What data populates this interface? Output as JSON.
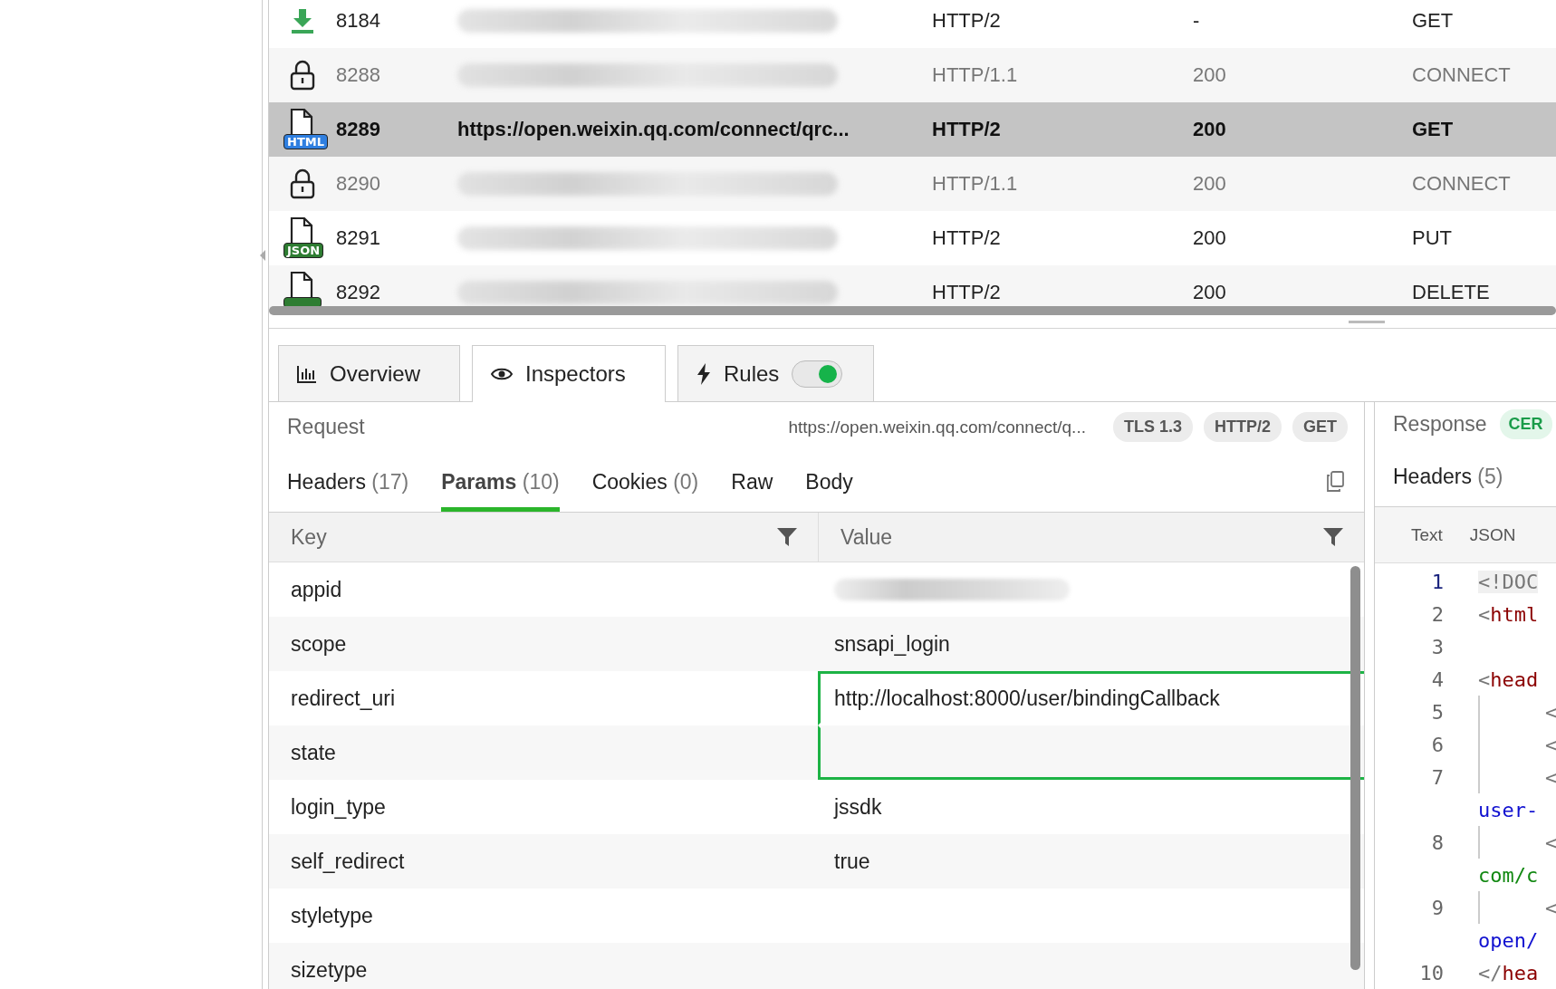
{
  "sessions": [
    {
      "id": "8184",
      "kind": "download",
      "redacted": true,
      "protocol": "HTTP/2",
      "status": "-",
      "method": "GET",
      "selected": false
    },
    {
      "id": "8288",
      "kind": "tunnel",
      "redacted": true,
      "protocol": "HTTP/1.1",
      "status": "200",
      "method": "CONNECT",
      "selected": false
    },
    {
      "id": "8289",
      "kind": "html",
      "badge": "HTML",
      "url": "https://open.weixin.qq.com/connect/qrc...",
      "protocol": "HTTP/2",
      "status": "200",
      "method": "GET",
      "selected": true
    },
    {
      "id": "8290",
      "kind": "tunnel",
      "redacted": true,
      "protocol": "HTTP/1.1",
      "status": "200",
      "method": "CONNECT",
      "selected": false
    },
    {
      "id": "8291",
      "kind": "json",
      "badge": "JSON",
      "redacted": true,
      "protocol": "HTTP/2",
      "status": "200",
      "method": "PUT",
      "selected": false
    },
    {
      "id": "8292",
      "kind": "json",
      "redacted": true,
      "protocol": "HTTP/2",
      "status": "200",
      "method": "DELETE",
      "selected": false
    }
  ],
  "tabs": [
    {
      "kind": "overview",
      "label": "Overview",
      "selected": false
    },
    {
      "kind": "inspectors",
      "label": "Inspectors",
      "selected": true
    },
    {
      "kind": "rules",
      "label": "Rules",
      "selected": false,
      "toggle_on": true
    }
  ],
  "request": {
    "title": "Request",
    "url": "https://open.weixin.qq.com/connect/q...",
    "badges": [
      "TLS 1.3",
      "HTTP/2",
      "GET"
    ],
    "subtabs": [
      {
        "label": "Headers",
        "count": "(17)",
        "selected": false
      },
      {
        "label": "Params",
        "count": "(10)",
        "selected": true
      },
      {
        "label": "Cookies",
        "count": "(0)",
        "selected": false
      },
      {
        "label": "Raw",
        "selected": false
      },
      {
        "label": "Body",
        "selected": false
      }
    ],
    "columns": [
      "Key",
      "Value"
    ],
    "params": [
      {
        "key": "appid",
        "redacted": true
      },
      {
        "key": "scope",
        "value": "snsapi_login"
      },
      {
        "key": "redirect_uri",
        "value": "http://localhost:8000/user/bindingCallback",
        "highlighted": true
      },
      {
        "key": "state",
        "highlighted": true
      },
      {
        "key": "login_type",
        "value": "jssdk"
      },
      {
        "key": "self_redirect",
        "value": "true"
      },
      {
        "key": "styletype"
      },
      {
        "key": "sizetype"
      }
    ]
  },
  "response": {
    "title": "Response",
    "badge": "CER",
    "subtabs": [
      {
        "label": "Headers",
        "count": "(5)",
        "selected": false
      }
    ],
    "views": [
      {
        "label": "Text",
        "selected": false
      },
      {
        "label": "JSON",
        "selected": false
      }
    ],
    "code_lines": [
      {
        "number": "1",
        "active": true,
        "tokens": [
          {
            "kind": "punct",
            "text": "<!DOC"
          }
        ]
      },
      {
        "number": "2",
        "tokens": [
          {
            "kind": "punct",
            "text": "<"
          },
          {
            "kind": "tag",
            "text": "html"
          }
        ]
      },
      {
        "number": "3"
      },
      {
        "number": "4",
        "tokens": [
          {
            "kind": "punct",
            "text": "<"
          },
          {
            "kind": "tag",
            "text": "head"
          }
        ]
      },
      {
        "number": "5",
        "indented": true,
        "tokens": [
          {
            "kind": "punct",
            "text": "<"
          }
        ]
      },
      {
        "number": "6",
        "indented": true,
        "tokens": [
          {
            "kind": "punct",
            "text": "<"
          }
        ]
      },
      {
        "number": "7",
        "indented": true,
        "tokens": [
          {
            "kind": "punct",
            "text": "<"
          }
        ]
      },
      {
        "tokens": [
          {
            "kind": "attr",
            "text": "user-"
          }
        ]
      },
      {
        "number": "8",
        "indented": true,
        "tokens": [
          {
            "kind": "punct",
            "text": "<"
          }
        ]
      },
      {
        "tokens": [
          {
            "kind": "string",
            "text": "com/c"
          }
        ]
      },
      {
        "number": "9",
        "indented": true,
        "tokens": [
          {
            "kind": "punct",
            "text": "<"
          }
        ]
      },
      {
        "tokens": [
          {
            "kind": "attr",
            "text": "open/"
          }
        ]
      },
      {
        "number": "10",
        "tokens": [
          {
            "kind": "punct",
            "text": "</"
          },
          {
            "kind": "tag",
            "text": "hea"
          }
        ]
      }
    ]
  }
}
